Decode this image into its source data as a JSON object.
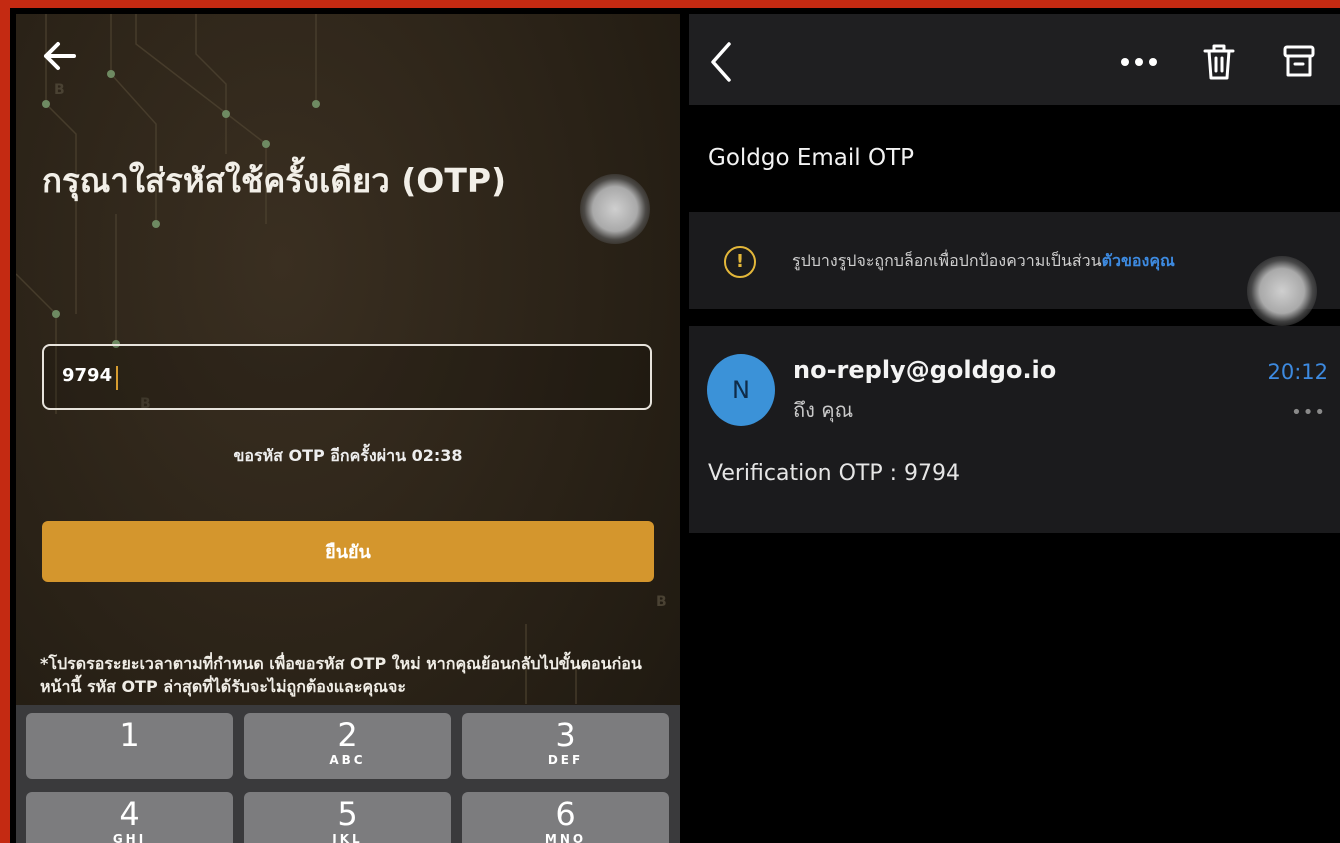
{
  "otp_screen": {
    "title": "กรุณาใส่รหัสใช้ครั้งเดียว (OTP)",
    "otp_value": "9794",
    "resend_text": "ขอรหัส OTP อีกครั้งผ่าน 02:38",
    "confirm_label": "ยืนยัน",
    "note": "*โปรดรอระยะเวลาตามที่กำหนด เพื่อขอรหัส OTP ใหม่ หากคุณย้อนกลับไปขั้นตอนก่อนหน้านี้ รหัส OTP ล่าสุดที่ได้รับจะไม่ถูกต้องและคุณจะ",
    "back_icon": "arrow-left-icon",
    "accent_color": "#d4962d",
    "keypad": [
      {
        "num": "1",
        "letters": ""
      },
      {
        "num": "2",
        "letters": "ABC"
      },
      {
        "num": "3",
        "letters": "DEF"
      },
      {
        "num": "4",
        "letters": "GHI"
      },
      {
        "num": "5",
        "letters": "JKL"
      },
      {
        "num": "6",
        "letters": "MNO"
      }
    ]
  },
  "email": {
    "toolbar_icons": [
      "chevron-left-icon",
      "more-horizontal-icon",
      "trash-icon",
      "archive-icon"
    ],
    "subject": "Goldgo Email OTP",
    "banner": {
      "text": "รูปบางรูปจะถูกบล็อกเพื่อปกป้องความเป็นส่วน",
      "link": "ตัวของคุณ",
      "icon": "warning-icon"
    },
    "message": {
      "avatar_letter": "N",
      "sender": "no-reply@goldgo.io",
      "to": "ถึง คุณ",
      "time": "20:12",
      "body": "Verification OTP : 9794"
    },
    "link_color": "#3d8ae0"
  }
}
